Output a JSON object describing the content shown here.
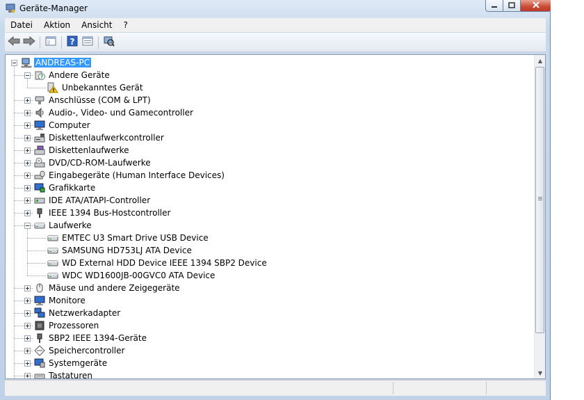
{
  "window": {
    "title": "Geräte-Manager"
  },
  "menu": [
    {
      "label": "Datei"
    },
    {
      "label": "Aktion"
    },
    {
      "label": "Ansicht"
    },
    {
      "label": "?"
    }
  ],
  "toolbar": [
    {
      "name": "back-button",
      "icon": "arrow-left-icon"
    },
    {
      "name": "forward-button",
      "icon": "arrow-right-icon"
    },
    {
      "name": "properties-view-button",
      "icon": "console-tree-icon"
    },
    {
      "name": "help-button",
      "icon": "help-icon"
    },
    {
      "name": "properties-button",
      "icon": "properties-icon"
    },
    {
      "name": "scan-hardware-button",
      "icon": "scan-hardware-icon"
    }
  ],
  "tree": [
    {
      "label": "ANDREAS-PC",
      "level": 0,
      "expander": "minus",
      "icon": "computer-icon",
      "selected": true
    },
    {
      "label": "Andere Geräte",
      "level": 1,
      "expander": "minus",
      "icon": "unknown-device-icon"
    },
    {
      "label": "Unbekanntes Gerät",
      "level": 2,
      "expander": "none",
      "icon": "warning-device-icon"
    },
    {
      "label": "Anschlüsse (COM & LPT)",
      "level": 1,
      "expander": "plus",
      "icon": "port-icon"
    },
    {
      "label": "Audio-, Video- und Gamecontroller",
      "level": 1,
      "expander": "plus",
      "icon": "speaker-icon"
    },
    {
      "label": "Computer",
      "level": 1,
      "expander": "plus",
      "icon": "monitor-icon"
    },
    {
      "label": "Diskettenlaufwerkcontroller",
      "level": 1,
      "expander": "plus",
      "icon": "floppy-controller-icon"
    },
    {
      "label": "Diskettenlaufwerke",
      "level": 1,
      "expander": "plus",
      "icon": "floppy-drive-icon"
    },
    {
      "label": "DVD/CD-ROM-Laufwerke",
      "level": 1,
      "expander": "plus",
      "icon": "dvd-drive-icon"
    },
    {
      "label": "Eingabegeräte (Human Interface Devices)",
      "level": 1,
      "expander": "plus",
      "icon": "hid-icon"
    },
    {
      "label": "Grafikkarte",
      "level": 1,
      "expander": "plus",
      "icon": "display-adapter-icon"
    },
    {
      "label": "IDE ATA/ATAPI-Controller",
      "level": 1,
      "expander": "plus",
      "icon": "ide-controller-icon"
    },
    {
      "label": "IEEE 1394 Bus-Hostcontroller",
      "level": 1,
      "expander": "plus",
      "icon": "firewire-icon"
    },
    {
      "label": "Laufwerke",
      "level": 1,
      "expander": "minus",
      "icon": "disk-drive-icon"
    },
    {
      "label": "EMTEC U3 Smart Drive USB Device",
      "level": 2,
      "expander": "none",
      "icon": "disk-drive-icon"
    },
    {
      "label": "SAMSUNG HD753LJ ATA Device",
      "level": 2,
      "expander": "none",
      "icon": "disk-drive-icon"
    },
    {
      "label": "WD External HDD Device IEEE 1394 SBP2 Device",
      "level": 2,
      "expander": "none",
      "icon": "disk-drive-icon"
    },
    {
      "label": "WDC WD1600JB-00GVC0 ATA Device",
      "level": 2,
      "expander": "none",
      "icon": "disk-drive-icon"
    },
    {
      "label": "Mäuse und andere Zeigegeräte",
      "level": 1,
      "expander": "plus",
      "icon": "mouse-icon"
    },
    {
      "label": "Monitore",
      "level": 1,
      "expander": "plus",
      "icon": "monitor-icon"
    },
    {
      "label": "Netzwerkadapter",
      "level": 1,
      "expander": "plus",
      "icon": "network-adapter-icon"
    },
    {
      "label": "Prozessoren",
      "level": 1,
      "expander": "plus",
      "icon": "processor-icon"
    },
    {
      "label": "SBP2 IEEE 1394-Geräte",
      "level": 1,
      "expander": "plus",
      "icon": "firewire-icon"
    },
    {
      "label": "Speichercontroller",
      "level": 1,
      "expander": "plus",
      "icon": "storage-controller-icon"
    },
    {
      "label": "Systemgeräte",
      "level": 1,
      "expander": "plus",
      "icon": "system-device-icon"
    },
    {
      "label": "Tastaturen",
      "level": 1,
      "expander": "plus",
      "icon": "keyboard-icon"
    }
  ],
  "colors": {
    "selection": "#3399ff",
    "frame": "#c9d9ec",
    "close": "#c84a33"
  }
}
